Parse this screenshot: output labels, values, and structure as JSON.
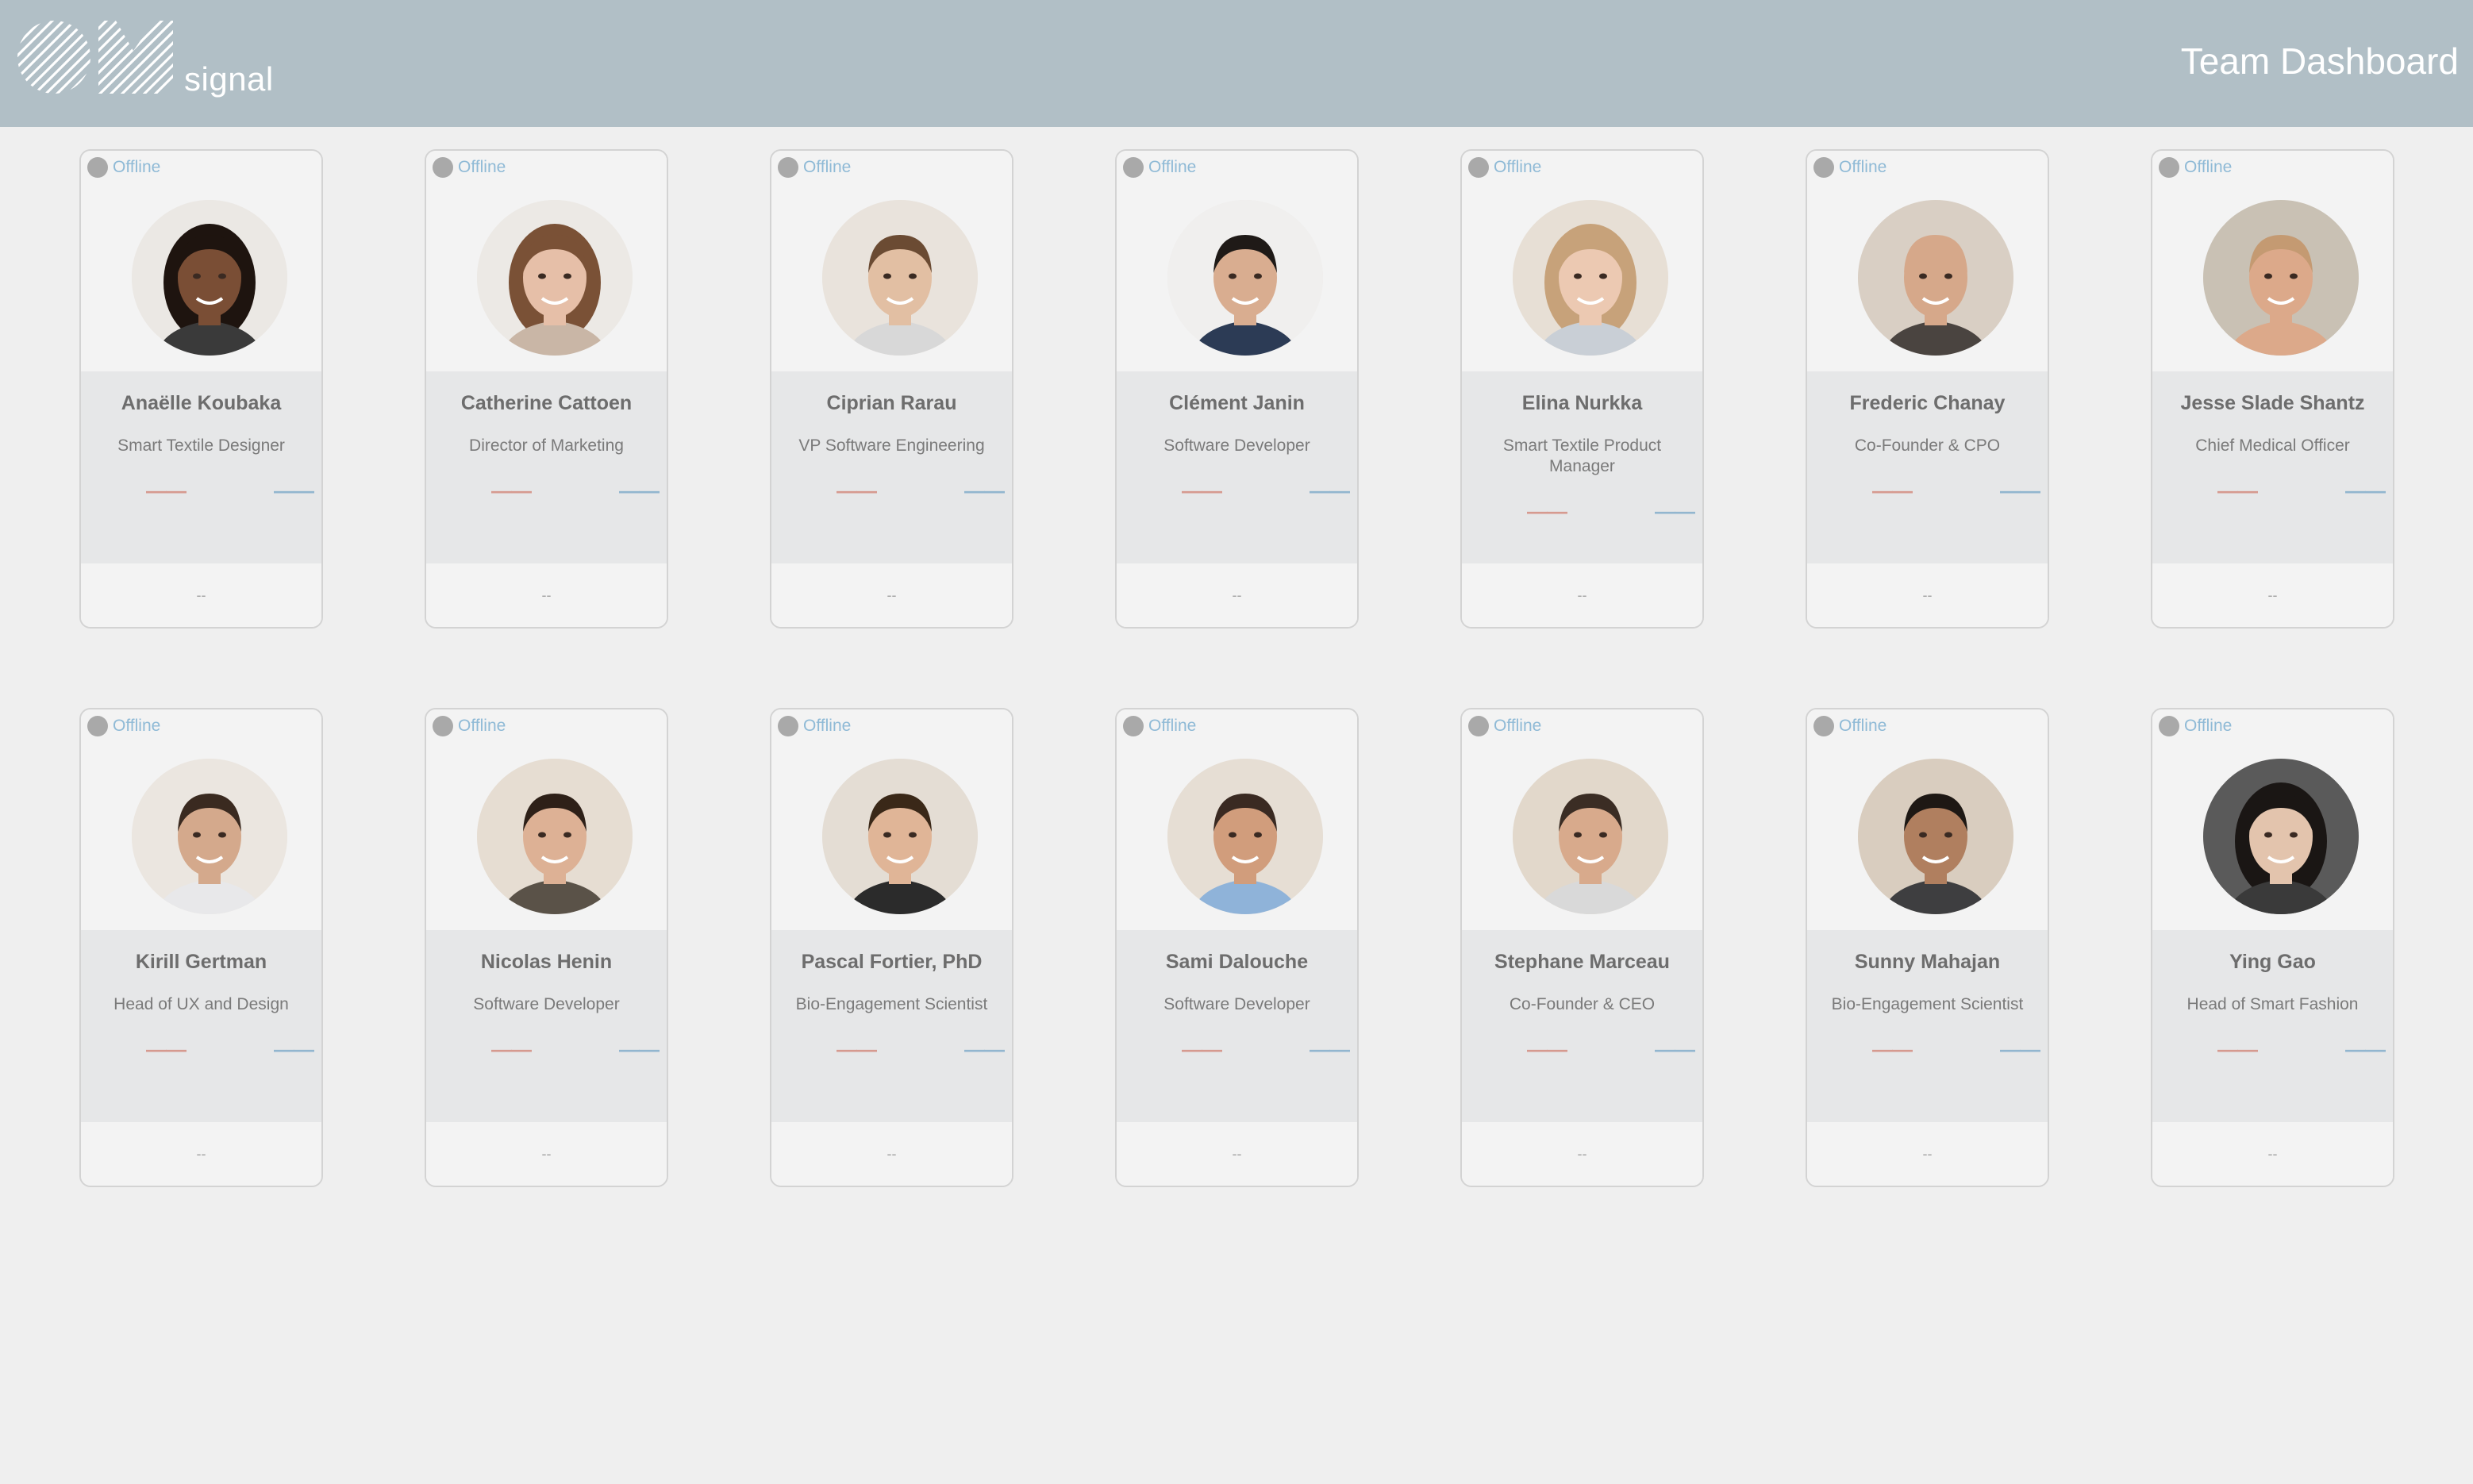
{
  "header": {
    "logo_text": "signal",
    "title": "Team Dashboard",
    "colors": {
      "bar": "#b1bfc6",
      "text": "#ffffff"
    }
  },
  "status_colors": {
    "offline_dot": "#a9a9a9",
    "offline_text": "#8fbad6",
    "metric_red": "#d69a8f",
    "metric_blue": "#92b6cf"
  },
  "members": [
    {
      "name": "Anaëlle Koubaka",
      "role": "Smart Textile Designer",
      "status": "Offline",
      "metric_left": "——",
      "metric_right": "——",
      "footer": "--",
      "skin": "#7a4e35",
      "hair": "#1e140f",
      "bg": "#ebe8e4",
      "shirt": "#3a3a3a",
      "long_hair": true
    },
    {
      "name": "Catherine Cattoen",
      "role": "Director of Marketing",
      "status": "Offline",
      "metric_left": "——",
      "metric_right": "——",
      "footer": "--",
      "skin": "#e6bfa8",
      "hair": "#7a5136",
      "bg": "#ece9e5",
      "shirt": "#c9b6a6",
      "long_hair": true
    },
    {
      "name": "Ciprian Rarau",
      "role": "VP Software Engineering",
      "status": "Offline",
      "metric_left": "——",
      "metric_right": "——",
      "footer": "--",
      "skin": "#e2bfa3",
      "hair": "#6b4b33",
      "bg": "#e9e3dc",
      "shirt": "#d8d8d8",
      "long_hair": false
    },
    {
      "name": "Clément Janin",
      "role": "Software Developer",
      "status": "Offline",
      "metric_left": "——",
      "metric_right": "——",
      "footer": "--",
      "skin": "#d9ad90",
      "hair": "#1f1a17",
      "bg": "#f0efee",
      "shirt": "#2c3b55",
      "long_hair": false
    },
    {
      "name": "Elina Nurkka",
      "role": "Smart Textile Product Manager",
      "status": "Offline",
      "metric_left": "——",
      "metric_right": "——",
      "footer": "--",
      "skin": "#ecc9b2",
      "hair": "#c7a27a",
      "bg": "#e7dfd5",
      "shirt": "#c9cfd6",
      "long_hair": true
    },
    {
      "name": "Frederic Chanay",
      "role": "Co-Founder & CPO",
      "status": "Offline",
      "metric_left": "——",
      "metric_right": "——",
      "footer": "--",
      "skin": "#d6a88a",
      "hair": "#d6a88a",
      "bg": "#d9cfc4",
      "shirt": "#4a4440",
      "long_hair": false
    },
    {
      "name": "Jesse Slade Shantz",
      "role": "Chief Medical Officer",
      "status": "Offline",
      "metric_left": "——",
      "metric_right": "——",
      "footer": "--",
      "skin": "#dca98a",
      "hair": "#c49a72",
      "bg": "#c9c1b4",
      "shirt": "#dca98a",
      "long_hair": false
    },
    {
      "name": "Kirill Gertman",
      "role": "Head of UX and Design",
      "status": "Offline",
      "metric_left": "——",
      "metric_right": "——",
      "footer": "--",
      "skin": "#d4a98c",
      "hair": "#3a2a20",
      "bg": "#ebe6e0",
      "shirt": "#e8e8ea",
      "long_hair": false
    },
    {
      "name": "Nicolas Henin",
      "role": "Software Developer",
      "status": "Offline",
      "metric_left": "——",
      "metric_right": "——",
      "footer": "--",
      "skin": "#ddb195",
      "hair": "#2e2018",
      "bg": "#e6ddd2",
      "shirt": "#5a5248",
      "long_hair": false
    },
    {
      "name": "Pascal Fortier, PhD",
      "role": "Bio-Engagement Scientist",
      "status": "Offline",
      "metric_left": "——",
      "metric_right": "——",
      "footer": "--",
      "skin": "#e0b597",
      "hair": "#3a2818",
      "bg": "#e4ddd4",
      "shirt": "#2b2b2b",
      "long_hair": false
    },
    {
      "name": "Sami Dalouche",
      "role": "Software Developer",
      "status": "Offline",
      "metric_left": "——",
      "metric_right": "——",
      "footer": "--",
      "skin": "#d19d7c",
      "hair": "#3a2a22",
      "bg": "#e6ded4",
      "shirt": "#8fb3d9",
      "long_hair": false
    },
    {
      "name": "Stephane Marceau",
      "role": "Co-Founder & CEO",
      "status": "Offline",
      "metric_left": "——",
      "metric_right": "——",
      "footer": "--",
      "skin": "#d8aa8c",
      "hair": "#3b2d24",
      "bg": "#e2d8cb",
      "shirt": "#d9d9d9",
      "long_hair": false
    },
    {
      "name": "Sunny Mahajan",
      "role": "Bio-Engagement Scientist",
      "status": "Offline",
      "metric_left": "——",
      "metric_right": "——",
      "footer": "--",
      "skin": "#b07f5f",
      "hair": "#1e1814",
      "bg": "#d9cdbf",
      "shirt": "#3e3e40",
      "long_hair": false
    },
    {
      "name": "Ying Gao",
      "role": "Head of Smart Fashion",
      "status": "Offline",
      "metric_left": "——",
      "metric_right": "——",
      "footer": "--",
      "skin": "#e3c4ad",
      "hair": "#1a1614",
      "bg": "#5a5a5a",
      "shirt": "#3a3a3a",
      "long_hair": true
    }
  ]
}
